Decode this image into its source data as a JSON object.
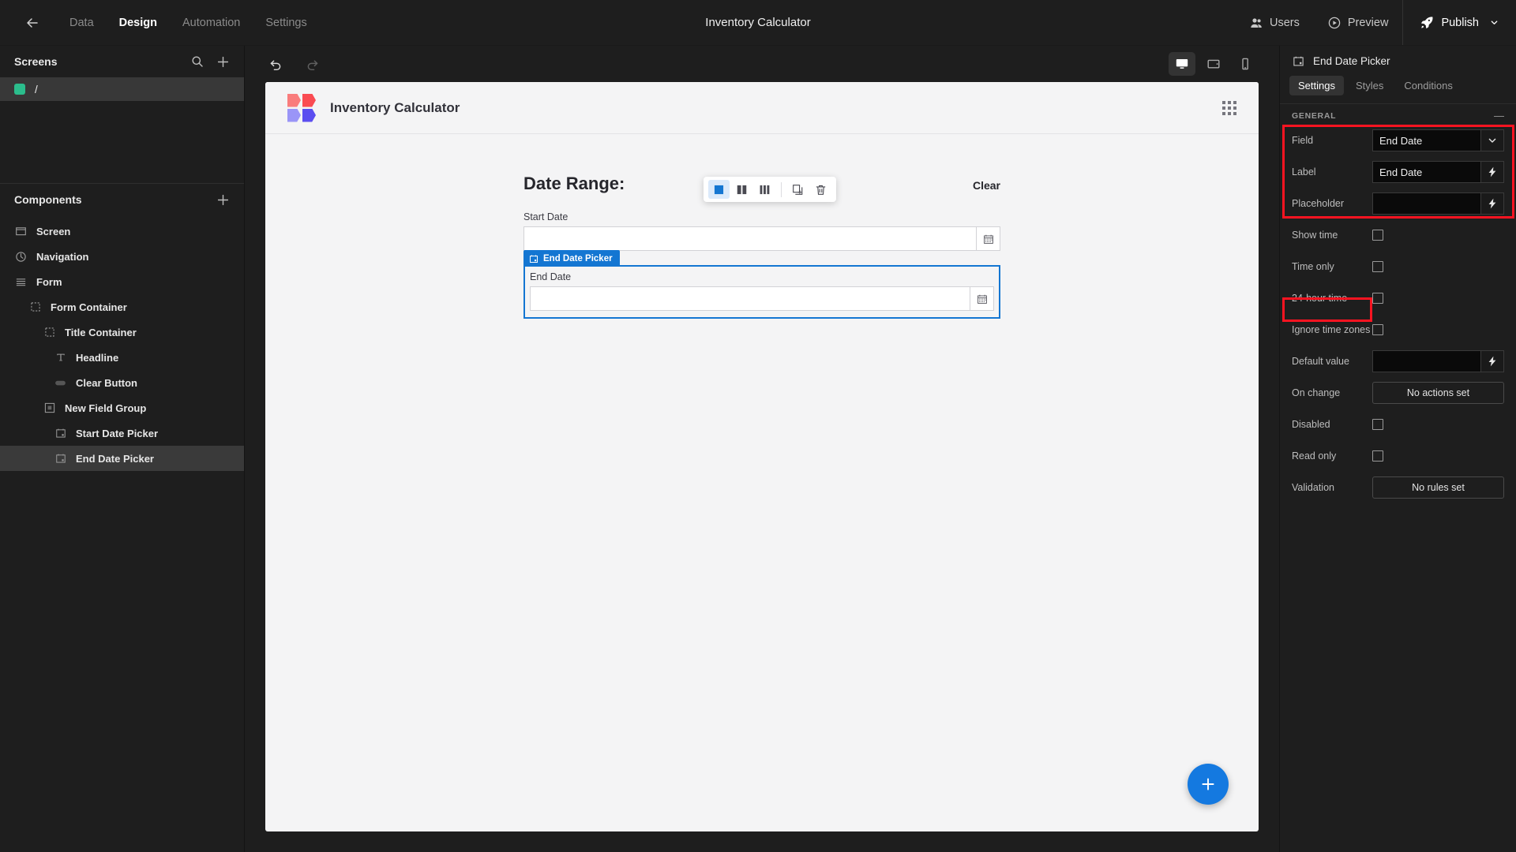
{
  "topbar": {
    "back_icon": "arrow-left-icon",
    "nav": [
      {
        "label": "Data",
        "active": false
      },
      {
        "label": "Design",
        "active": true
      },
      {
        "label": "Automation",
        "active": false
      },
      {
        "label": "Settings",
        "active": false
      }
    ],
    "app_title": "Inventory Calculator",
    "users_label": "Users",
    "preview_label": "Preview",
    "publish_label": "Publish",
    "users_icon": "users-icon",
    "preview_icon": "play-circle-icon",
    "publish_icon": "rocket-icon",
    "publish_chevron_icon": "chevron-down-icon"
  },
  "sidebar": {
    "screens_title": "Screens",
    "search_icon": "search-icon",
    "add_icon": "plus-icon",
    "screens": [
      {
        "label": "/",
        "dot_color": "#2bbd8c",
        "selected": true
      }
    ],
    "components_title": "Components",
    "components_add_icon": "plus-icon",
    "tree": [
      {
        "label": "Screen",
        "depth": 1,
        "icon": "screen-icon",
        "selected": false
      },
      {
        "label": "Navigation",
        "depth": 1,
        "icon": "navigation-icon",
        "selected": false
      },
      {
        "label": "Form",
        "depth": 1,
        "icon": "form-icon",
        "selected": false
      },
      {
        "label": "Form Container",
        "depth": 2,
        "icon": "container-icon",
        "selected": false
      },
      {
        "label": "Title Container",
        "depth": 3,
        "icon": "container-icon",
        "selected": false
      },
      {
        "label": "Headline",
        "depth": 4,
        "icon": "text-icon",
        "selected": false
      },
      {
        "label": "Clear Button",
        "depth": 4,
        "icon": "button-icon",
        "selected": false
      },
      {
        "label": "New Field Group",
        "depth": 3,
        "icon": "field-group-icon",
        "selected": false
      },
      {
        "label": "Start Date Picker",
        "depth": 4,
        "icon": "calendar-icon",
        "selected": false
      },
      {
        "label": "End Date Picker",
        "depth": 4,
        "icon": "calendar-icon",
        "selected": true
      }
    ]
  },
  "canvas_bar": {
    "undo_icon": "undo-icon",
    "redo_icon": "redo-icon",
    "undo_enabled": true,
    "redo_enabled": false,
    "devices": [
      {
        "name": "desktop",
        "icon": "desktop-icon",
        "active": true
      },
      {
        "name": "tablet",
        "icon": "tablet-icon",
        "active": false
      },
      {
        "name": "mobile",
        "icon": "mobile-icon",
        "active": false
      }
    ]
  },
  "canvas": {
    "app_name": "Inventory Calculator",
    "logo_name": "app-logo",
    "grid_icon": "grid-dots-icon",
    "form_title": "Date Range:",
    "clear_label": "Clear",
    "fields": [
      {
        "label": "Start Date",
        "value": "",
        "calendar_icon": "calendar-icon",
        "selected": false
      },
      {
        "label": "End Date",
        "value": "",
        "calendar_icon": "calendar-icon",
        "selected": true,
        "tag_label": "End Date Picker",
        "tag_icon": "calendar-icon",
        "tag_color": "#1476d2"
      }
    ],
    "float_toolbar": {
      "items": [
        {
          "name": "one-column",
          "icon": "single-column-icon",
          "active": true
        },
        {
          "name": "two-columns",
          "icon": "two-column-icon",
          "active": false
        },
        {
          "name": "three-columns",
          "icon": "three-column-icon",
          "active": false
        },
        {
          "name": "duplicate",
          "icon": "duplicate-icon",
          "active": false
        },
        {
          "name": "delete",
          "icon": "trash-icon",
          "active": false
        }
      ]
    },
    "fab_label": "+",
    "fab_icon": "plus-icon",
    "fab_color": "#1479e0"
  },
  "right_panel": {
    "header_title": "End Date Picker",
    "header_icon": "calendar-icon",
    "tabs": [
      {
        "label": "Settings",
        "active": true
      },
      {
        "label": "Styles",
        "active": false
      },
      {
        "label": "Conditions",
        "active": false
      }
    ],
    "section_title": "GENERAL",
    "collapse_icon": "minus-icon",
    "rows": [
      {
        "label": "Field",
        "type": "select",
        "value": "End Date",
        "addon_icon": "chevron-down-icon"
      },
      {
        "label": "Label",
        "type": "input",
        "value": "End Date",
        "addon_icon": "lightning-icon"
      },
      {
        "label": "Placeholder",
        "type": "input",
        "value": "",
        "addon_icon": "lightning-icon"
      },
      {
        "label": "Show time",
        "type": "checkbox",
        "checked": false
      },
      {
        "label": "Time only",
        "type": "checkbox",
        "checked": false
      },
      {
        "label": "24-hour time",
        "type": "checkbox",
        "checked": false
      },
      {
        "label": "Ignore time zones",
        "type": "checkbox",
        "checked": false
      },
      {
        "label": "Default value",
        "type": "input",
        "value": "",
        "addon_icon": "lightning-icon"
      },
      {
        "label": "On change",
        "type": "button",
        "value": "No actions set"
      },
      {
        "label": "Disabled",
        "type": "checkbox",
        "checked": false
      },
      {
        "label": "Read only",
        "type": "checkbox",
        "checked": false
      },
      {
        "label": "Validation",
        "type": "button",
        "value": "No rules set"
      }
    ],
    "annotation_color": "#fb1421"
  }
}
